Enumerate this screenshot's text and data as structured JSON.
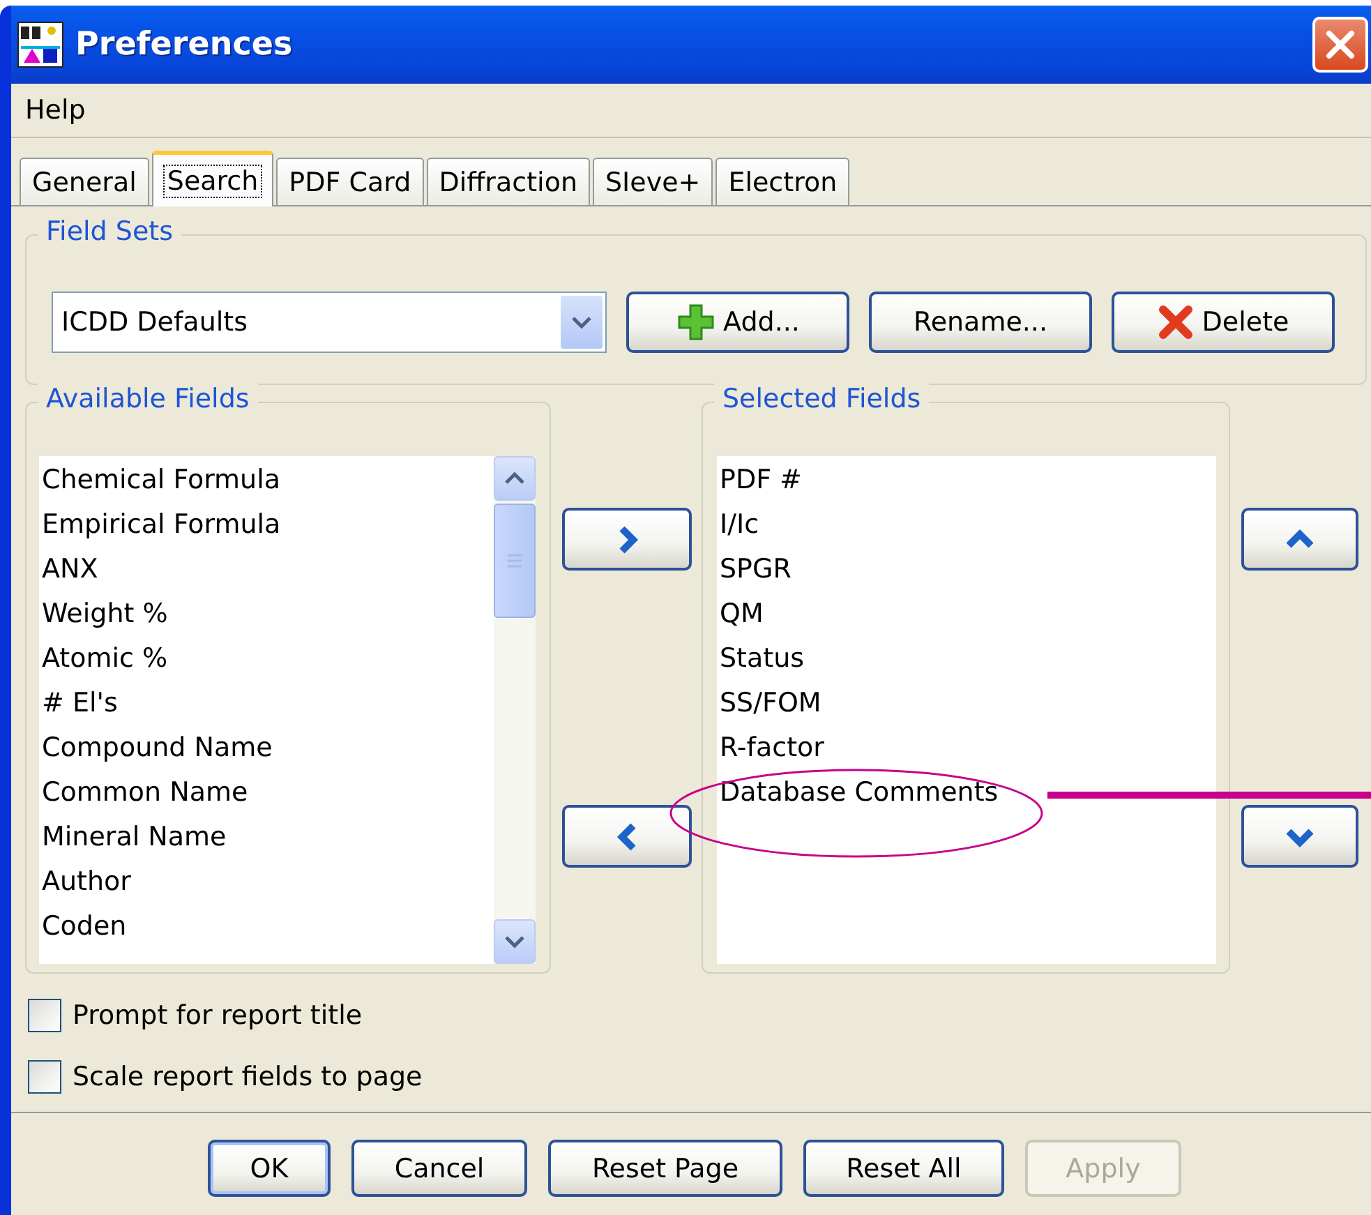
{
  "window": {
    "title": "Preferences"
  },
  "menu": [
    "Help"
  ],
  "tabs": [
    {
      "label": "General",
      "selected": false
    },
    {
      "label": "Search",
      "selected": true
    },
    {
      "label": "PDF Card",
      "selected": false
    },
    {
      "label": "Diffraction",
      "selected": false
    },
    {
      "label": "SIeve+",
      "selected": false
    },
    {
      "label": "Electron",
      "selected": false
    }
  ],
  "field_sets": {
    "title": "Field Sets",
    "value": "ICDD Defaults",
    "buttons": [
      {
        "label": "Add...",
        "kind": "add"
      },
      {
        "label": "Rename...",
        "kind": "plain"
      },
      {
        "label": "Delete",
        "kind": "delete"
      }
    ]
  },
  "available_fields": {
    "title": "Available Fields",
    "items": [
      "Chemical Formula",
      "Empirical Formula",
      "ANX",
      "Weight %",
      "Atomic %",
      "# El's",
      "Compound Name",
      "Common Name",
      "Mineral Name",
      "Author",
      "Coden"
    ]
  },
  "selected_fields": {
    "title": "Selected Fields",
    "items": [
      "PDF #",
      "I/Ic",
      "SPGR",
      "QM",
      "Status",
      "SS/FOM",
      "R-factor",
      "Database Comments"
    ]
  },
  "options": [
    {
      "label": "Prompt for report title",
      "checked": false
    },
    {
      "label": "Scale report fields to page",
      "checked": false
    }
  ],
  "buttons": [
    {
      "label": "OK",
      "default": true,
      "disabled": false
    },
    {
      "label": "Cancel",
      "default": false,
      "disabled": false
    },
    {
      "label": "Reset Page",
      "default": false,
      "disabled": false
    },
    {
      "label": "Reset All",
      "default": false,
      "disabled": false
    },
    {
      "label": "Apply",
      "default": false,
      "disabled": true
    }
  ]
}
